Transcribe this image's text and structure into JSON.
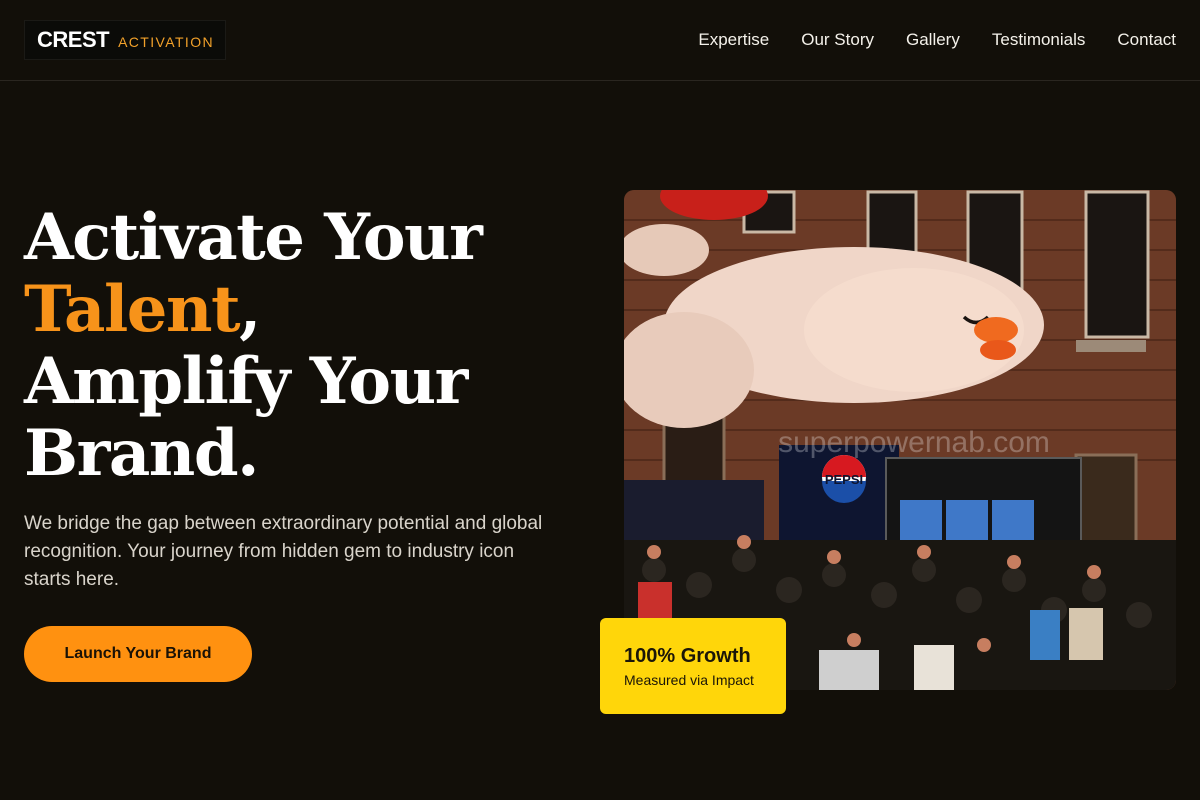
{
  "brand": {
    "name": "CREST",
    "tagline": "ACTIVATION"
  },
  "nav": {
    "items": [
      {
        "label": "Expertise"
      },
      {
        "label": "Our Story"
      },
      {
        "label": "Gallery"
      },
      {
        "label": "Testimonials"
      },
      {
        "label": "Contact"
      }
    ]
  },
  "hero": {
    "title_line1": "Activate Your",
    "title_accent": "Talent",
    "title_comma": ",",
    "title_line3": "Amplify Your",
    "title_line4": "Brand.",
    "description": "We bridge the gap between extraordinary potential and global recognition. Your journey from hidden gem to industry icon starts here.",
    "cta_label": "Launch Your Brand"
  },
  "image": {
    "sign_text": "PEPSI",
    "watermark": "superpowernab.com"
  },
  "badge": {
    "title": "100% Growth",
    "subtitle": "Measured via Impact"
  },
  "colors": {
    "background": "#120f09",
    "accent": "#f7931a",
    "cta": "#ff9110",
    "badge": "#ffd60a"
  }
}
